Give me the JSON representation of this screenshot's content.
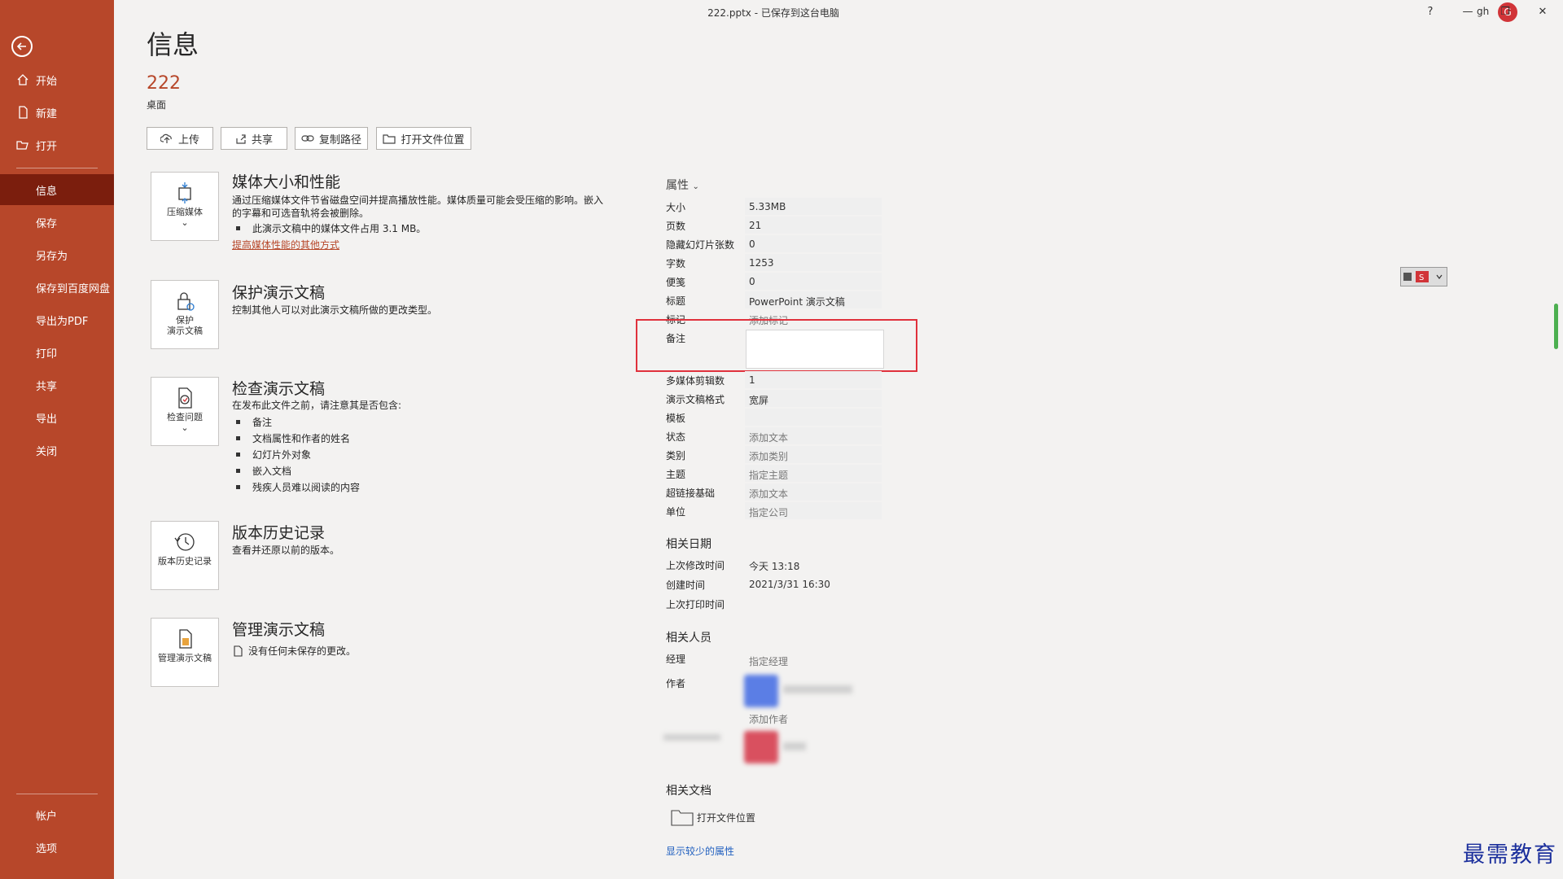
{
  "window": {
    "title": "222.pptx - 已保存到这台电脑",
    "user_initials": "gh",
    "user_avatar_letter": "G",
    "help_label": "?",
    "minimize_label": "—",
    "restore_label": "❐",
    "close_label": "✕"
  },
  "sidebar": {
    "items": [
      {
        "label": "开始",
        "icon": "home-icon"
      },
      {
        "label": "新建",
        "icon": "new-doc-icon"
      },
      {
        "label": "打开",
        "icon": "open-folder-icon"
      },
      {
        "label": "信息"
      },
      {
        "label": "保存"
      },
      {
        "label": "另存为"
      },
      {
        "label": "保存到百度网盘"
      },
      {
        "label": "导出为PDF"
      },
      {
        "label": "打印"
      },
      {
        "label": "共享"
      },
      {
        "label": "导出"
      },
      {
        "label": "关闭"
      }
    ],
    "bottom": [
      {
        "label": "帐户"
      },
      {
        "label": "选项"
      }
    ],
    "active_item": "信息",
    "accent_color": "#b7472a",
    "active_color": "#7b1e0d"
  },
  "main": {
    "page_title": "信息",
    "doc_name": "222",
    "doc_location": "桌面",
    "actions": {
      "upload": "上传",
      "share": "共享",
      "copy_path": "复制路径",
      "open_location": "打开文件位置"
    },
    "media": {
      "tile": "压缩媒体",
      "title": "媒体大小和性能",
      "desc": "通过压缩媒体文件节省磁盘空间并提高播放性能。媒体质量可能会受压缩的影响。嵌入的字幕和可选音轨将会被删除。",
      "bullet": "此演示文稿中的媒体文件占用 3.1 MB。",
      "link": "提高媒体性能的其他方式"
    },
    "protect": {
      "tile_line1": "保护",
      "tile_line2": "演示文稿",
      "title": "保护演示文稿",
      "desc": "控制其他人可以对此演示文稿所做的更改类型。"
    },
    "inspect": {
      "tile": "检查问题",
      "title": "检查演示文稿",
      "desc": "在发布此文件之前，请注意其是否包含:",
      "bullets": [
        "备注",
        "文档属性和作者的姓名",
        "幻灯片外对象",
        "嵌入文档",
        "残疾人员难以阅读的内容"
      ]
    },
    "history": {
      "tile": "版本历史记录",
      "title": "版本历史记录",
      "desc": "查看并还原以前的版本。"
    },
    "manage": {
      "tile": "管理演示文稿",
      "title": "管理演示文稿",
      "desc": "没有任何未保存的更改。"
    }
  },
  "properties": {
    "header": "属性",
    "rows": [
      {
        "label": "大小",
        "value": "5.33MB"
      },
      {
        "label": "页数",
        "value": "21"
      },
      {
        "label": "隐藏幻灯片张数",
        "value": "0"
      },
      {
        "label": "字数",
        "value": "1253"
      },
      {
        "label": "便笺",
        "value": "0"
      },
      {
        "label": "标题",
        "value": "PowerPoint 演示文稿"
      },
      {
        "label": "标记",
        "value": "添加标记"
      },
      {
        "label": "备注",
        "value": ""
      },
      {
        "label": "多媒体剪辑数",
        "value": "1"
      },
      {
        "label": "演示文稿格式",
        "value": "宽屏"
      },
      {
        "label": "模板",
        "value": ""
      },
      {
        "label": "状态",
        "value": "添加文本"
      },
      {
        "label": "类别",
        "value": "添加类别"
      },
      {
        "label": "主题",
        "value": "指定主题"
      },
      {
        "label": "超链接基础",
        "value": "添加文本"
      },
      {
        "label": "单位",
        "value": "指定公司"
      }
    ],
    "dates_header": "相关日期",
    "dates": [
      {
        "label": "上次修改时间",
        "value": "今天 13:18"
      },
      {
        "label": "创建时间",
        "value": "2021/3/31 16:30"
      },
      {
        "label": "上次打印时间",
        "value": ""
      }
    ],
    "people_header": "相关人员",
    "manager_label": "经理",
    "manager_value": "指定经理",
    "author_label": "作者",
    "add_author": "添加作者",
    "docs_header": "相关文档",
    "open_location": "打开文件位置",
    "show_less": "显示较少的属性"
  },
  "watermark": "最需教育"
}
